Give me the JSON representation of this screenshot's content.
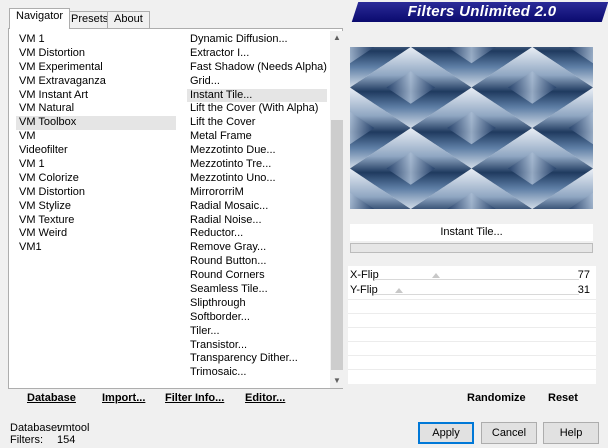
{
  "tabs": [
    {
      "label": "Navigator",
      "active": true
    },
    {
      "label": "Presets",
      "active": false
    },
    {
      "label": "About",
      "active": false
    }
  ],
  "categories": [
    "VM 1",
    "VM Distortion",
    "VM Experimental",
    "VM Extravaganza",
    "VM Instant Art",
    "VM Natural",
    "VM Toolbox",
    "VM",
    "Videofilter",
    "VM 1",
    "VM Colorize",
    "VM Distortion",
    "VM Stylize",
    "VM Texture",
    "VM Weird",
    "VM1"
  ],
  "selected_category": "VM Toolbox",
  "filters": [
    "Dynamic Diffusion...",
    "Extractor I...",
    "Fast Shadow (Needs Alpha)",
    "Grid...",
    "Instant Tile...",
    "Lift the Cover (With Alpha)",
    "Lift the Cover",
    "Metal Frame",
    "Mezzotinto Due...",
    "Mezzotinto Tre...",
    "Mezzotinto Uno...",
    "MirrororriM",
    "Radial Mosaic...",
    "Radial Noise...",
    "Reductor...",
    "Remove Gray...",
    "Round Button...",
    "Round Corners",
    "Seamless Tile...",
    "Slipthrough",
    "Softborder...",
    "Tiler...",
    "Transistor...",
    "Transparency Dither...",
    "Trimosaic..."
  ],
  "selected_filter": "Instant Tile...",
  "left_buttons": {
    "database": "Database",
    "import": "Import...",
    "filter_info": "Filter Info...",
    "editor": "Editor..."
  },
  "header_title": "Filters Unlimited 2.0",
  "current_filter": "Instant Tile...",
  "params": [
    {
      "label": "X-Flip",
      "value": "77",
      "fraction": 0.302
    },
    {
      "label": "Y-Flip",
      "value": "31",
      "fraction": 0.122
    }
  ],
  "right_buttons": {
    "randomize": "Randomize",
    "reset": "Reset"
  },
  "footer": {
    "database_label": "Database:",
    "database_value": "vmtool",
    "filters_label": "Filters:",
    "filters_value": "154"
  },
  "dialog_buttons": {
    "apply": "Apply",
    "cancel": "Cancel",
    "help": "Help"
  },
  "colors": {
    "header_bg": "#1a1a82",
    "selection": "#e5e5e5",
    "default_button_border": "#0078d7",
    "preview_tile": "#2f4f7a"
  }
}
